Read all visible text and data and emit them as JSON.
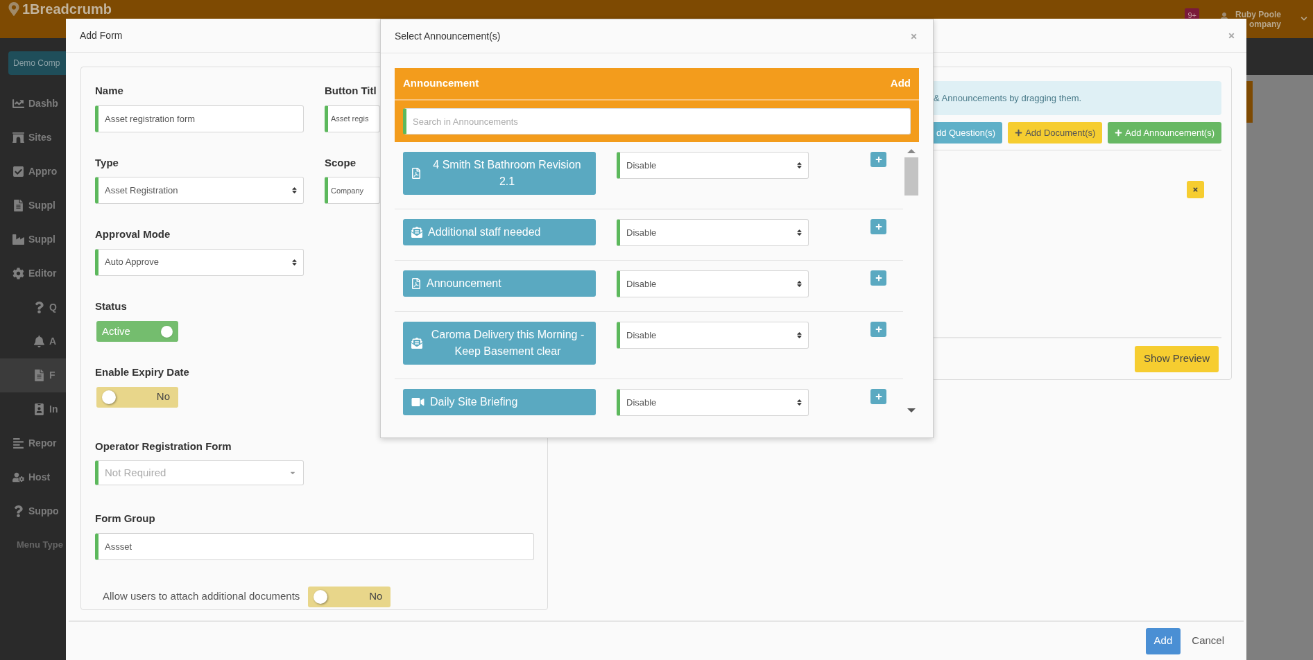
{
  "top_bar": {
    "logo": "1Breadcrumb",
    "badge": "9+",
    "user_name": "Ruby Poole",
    "user_company": "ompany"
  },
  "sidebar": {
    "company_button": "Demo Comp",
    "items": [
      {
        "label": "Dashb",
        "selected": false
      },
      {
        "label": "Sites",
        "selected": false
      },
      {
        "label": "Appro",
        "selected": false
      },
      {
        "label": "Suppl",
        "selected": false
      },
      {
        "label": "Suppl",
        "selected": false
      },
      {
        "label": "Editor",
        "selected": false,
        "children": [
          {
            "label": "Q",
            "selected": false
          },
          {
            "label": "A",
            "selected": false
          },
          {
            "label": "F",
            "selected": true
          },
          {
            "label": "In",
            "selected": false
          }
        ]
      },
      {
        "label": "Repor",
        "selected": false
      },
      {
        "label": "Host",
        "selected": false
      },
      {
        "label": "Suppo",
        "selected": false
      }
    ],
    "footer": "Menu Type"
  },
  "add_form": {
    "title": "Add Form",
    "name": {
      "label": "Name",
      "value": "Asset registration form"
    },
    "button_title": {
      "label": "Button Titl",
      "value": "Asset regis"
    },
    "type": {
      "label": "Type",
      "value": "Asset Registration"
    },
    "scope": {
      "label": "Scope",
      "value": "Company"
    },
    "approval_mode": {
      "label": "Approval Mode",
      "value": "Auto Approve"
    },
    "status": {
      "label": "Status",
      "on": true,
      "text": "Active"
    },
    "expiry": {
      "label": "Enable Expiry Date",
      "on": false,
      "text": "No"
    },
    "operator_form": {
      "label": "Operator Registration Form",
      "placeholder": "Not Required"
    },
    "form_group": {
      "label": "Form Group",
      "value": "Assset"
    },
    "attach": {
      "label": "Allow users to attach additional documents",
      "on": false,
      "text": "No"
    },
    "info": "& Announcements by dragging them.",
    "add_buttons": [
      {
        "kind": "question",
        "label": "dd Question(s)"
      },
      {
        "kind": "document",
        "label": "Add Document(s)"
      },
      {
        "kind": "announcement",
        "label": "Add Announcement(s)"
      }
    ],
    "preview_button": "Show Preview",
    "footer_buttons": [
      {
        "kind": "primary",
        "label": "Add"
      },
      {
        "kind": "link",
        "label": "Cancel"
      }
    ]
  },
  "select_modal": {
    "title": "Select Announcement(s)",
    "panel_title": "Announcement",
    "panel_action": "Add",
    "search_placeholder": "Search in Announcements",
    "rows": [
      {
        "kind": "document",
        "title": "4 Smith St Bathroom Revision 2.1",
        "option": "Disable"
      },
      {
        "kind": "message",
        "title": "Additional staff needed",
        "option": "Disable"
      },
      {
        "kind": "document",
        "title": "Announcement",
        "option": "Disable"
      },
      {
        "kind": "message",
        "title": "Caroma Delivery this Morning - Keep Basement clear",
        "option": "Disable"
      },
      {
        "kind": "video",
        "title": "Daily Site Briefing",
        "option": "Disable"
      }
    ]
  }
}
